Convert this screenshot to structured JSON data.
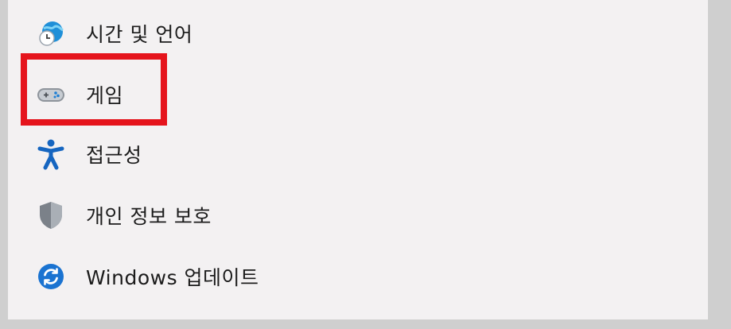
{
  "nav": {
    "items": [
      {
        "label": "시간 및 언어",
        "icon": "time-language-icon"
      },
      {
        "label": "게임",
        "icon": "gaming-icon"
      },
      {
        "label": "접근성",
        "icon": "accessibility-icon"
      },
      {
        "label": "개인 정보 보호",
        "icon": "privacy-shield-icon"
      },
      {
        "label": "Windows 업데이트",
        "icon": "windows-update-icon"
      }
    ]
  },
  "colors": {
    "panel_bg": "#f3f1f2",
    "frame_bg": "#cfcfcf",
    "highlight": "#e5141c",
    "text": "#1c1c1c",
    "accent": "#0f6cbd"
  }
}
